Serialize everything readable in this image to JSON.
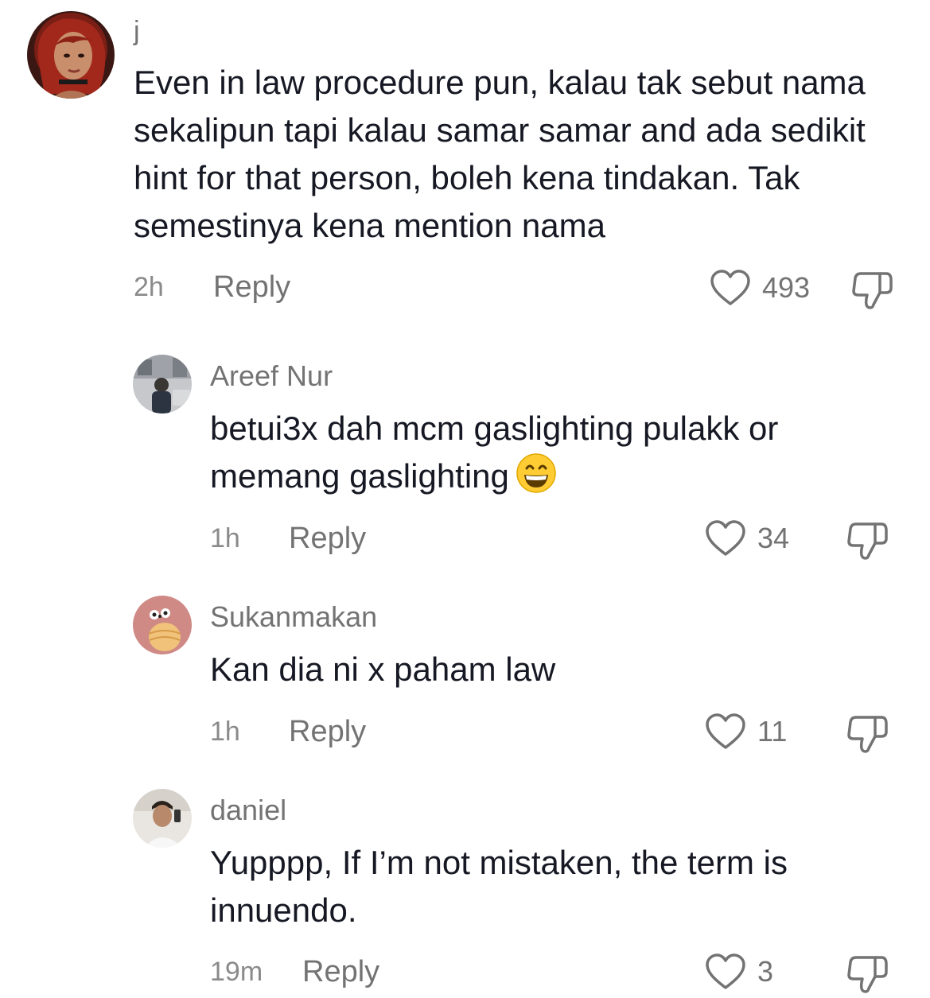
{
  "comments": [
    {
      "username": "j",
      "text": "Even in law procedure pun, kalau tak sebut nama sekalipun tapi kalau samar samar and ada sedikit hint for that person, boleh kena tindakan. Tak semestinya kena mention nama",
      "time": "2h",
      "reply_label": "Reply",
      "likes": "493"
    },
    {
      "username": "Areef Nur",
      "text": "betui3x dah mcm gaslighting pulakk or memang gaslighting",
      "emoji": "grinning-face-emoji",
      "time": "1h",
      "reply_label": "Reply",
      "likes": "34"
    },
    {
      "username": "Sukanmakan",
      "text": "Kan dia ni x paham law",
      "time": "1h",
      "reply_label": "Reply",
      "likes": "11"
    },
    {
      "username": "daniel",
      "text": "Yupppp, If I’m not mistaken, the term is innuendo.",
      "time": "19m",
      "reply_label": "Reply",
      "likes": "3"
    }
  ],
  "icons": {
    "like": "heart-outline-icon",
    "dislike": "thumbs-down-outline-icon"
  },
  "colors": {
    "text": "#161823",
    "muted": "#737373"
  }
}
